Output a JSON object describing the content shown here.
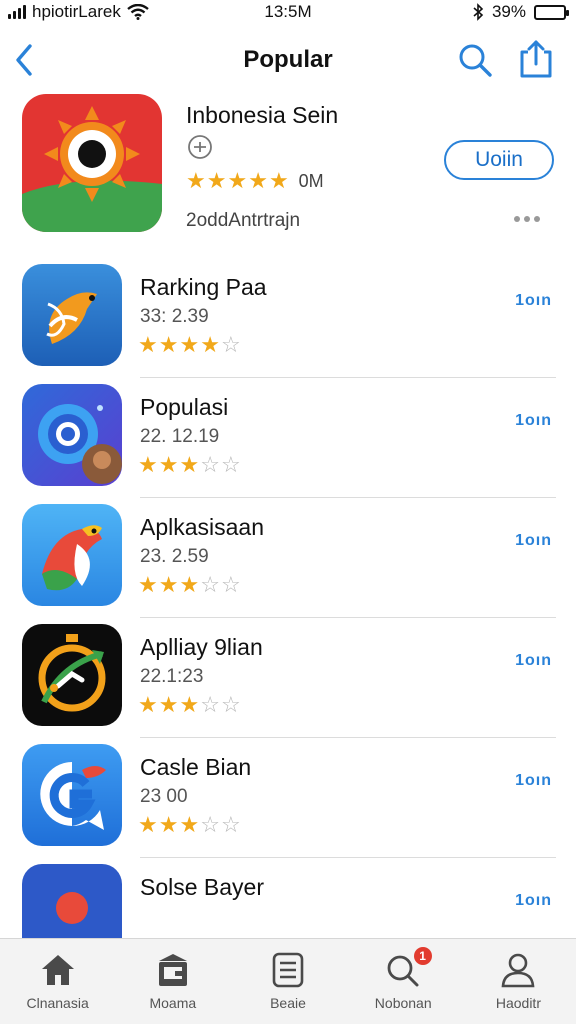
{
  "status_bar": {
    "carrier": "hpiotirLarek",
    "time": "13:5M",
    "battery_percent": "39%",
    "battery_level": 0.39
  },
  "nav": {
    "title": "Popular"
  },
  "featured": {
    "name": "Inbonesia Sein",
    "rating": 4.5,
    "downloads": "0M",
    "developer": "2oddАntrtrajn",
    "action_label": "Uoiin"
  },
  "apps": [
    {
      "name": "Rarking Paa",
      "meta": "33: 2.39",
      "rating": 3.5,
      "action": "1oın"
    },
    {
      "name": "Populasi",
      "meta": "22. 12.19",
      "rating": 2.5,
      "action": "1oın"
    },
    {
      "name": "Aplkasisaan",
      "meta": "23. 2.59",
      "rating": 2.5,
      "action": "1oın"
    },
    {
      "name": "Aplliay 9lian",
      "meta": "22.1:23",
      "rating": 3,
      "action": "1oın"
    },
    {
      "name": "Casle Bian",
      "meta": "23  00",
      "rating": 3,
      "action": "1oın"
    },
    {
      "name": "Solse Bayer",
      "meta": "",
      "rating": 0,
      "action": "1oın"
    }
  ],
  "tabs": [
    {
      "label": "Clnanasia",
      "icon": "home-icon"
    },
    {
      "label": "Moama",
      "icon": "store-icon"
    },
    {
      "label": "Beaie",
      "icon": "list-icon"
    },
    {
      "label": "Nobonan",
      "icon": "search-icon",
      "badge": "1"
    },
    {
      "label": "Haoditr",
      "icon": "profile-icon"
    }
  ],
  "colors": {
    "accent": "#2a82d8",
    "star": "#f1a81a",
    "badge": "#e23b2e"
  }
}
